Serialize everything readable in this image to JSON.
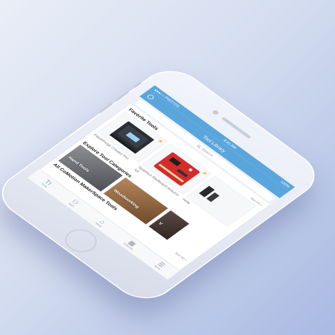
{
  "statusbar": {
    "carrier": "●●●○○ PHOTOS",
    "time": "9:41 AM",
    "battery": "100%"
  },
  "navbar": {
    "title": "Tool Library"
  },
  "search": {
    "placeholder": "Search",
    "icon": "search-icon"
  },
  "favorites": {
    "title": "Favorite Tools",
    "see_all": "See All  >",
    "items": [
      {
        "label": "FlashForge Creator Pro",
        "icon": "3d-printer"
      },
      {
        "label": "Sparkfun Redboard Arduino Kit",
        "icon": "circuit-board"
      },
      {
        "label": "Hole",
        "icon": "tool"
      }
    ]
  },
  "categories": {
    "title": "Explore Tool Categories",
    "items": [
      {
        "label": "Hand Tools"
      },
      {
        "label": "Woodworking"
      },
      {
        "label": "V"
      }
    ]
  },
  "all_tools": {
    "title": "All CoMotion MakerSpace Tools",
    "see_all": "See All  >"
  },
  "tabbar": {
    "items": [
      {
        "label": "Tools",
        "icon": "TI"
      },
      {
        "label": "Staff",
        "icon": "people"
      },
      {
        "label": "Home",
        "icon": "home"
      },
      {
        "label": "Calendar",
        "icon": "calendar"
      },
      {
        "label": "More",
        "icon": "more"
      }
    ]
  },
  "colors": {
    "accent": "#5aa6dc",
    "star": "#f2bd2c",
    "background_start": "#e9eef7",
    "background_end": "#a9b9e2"
  }
}
